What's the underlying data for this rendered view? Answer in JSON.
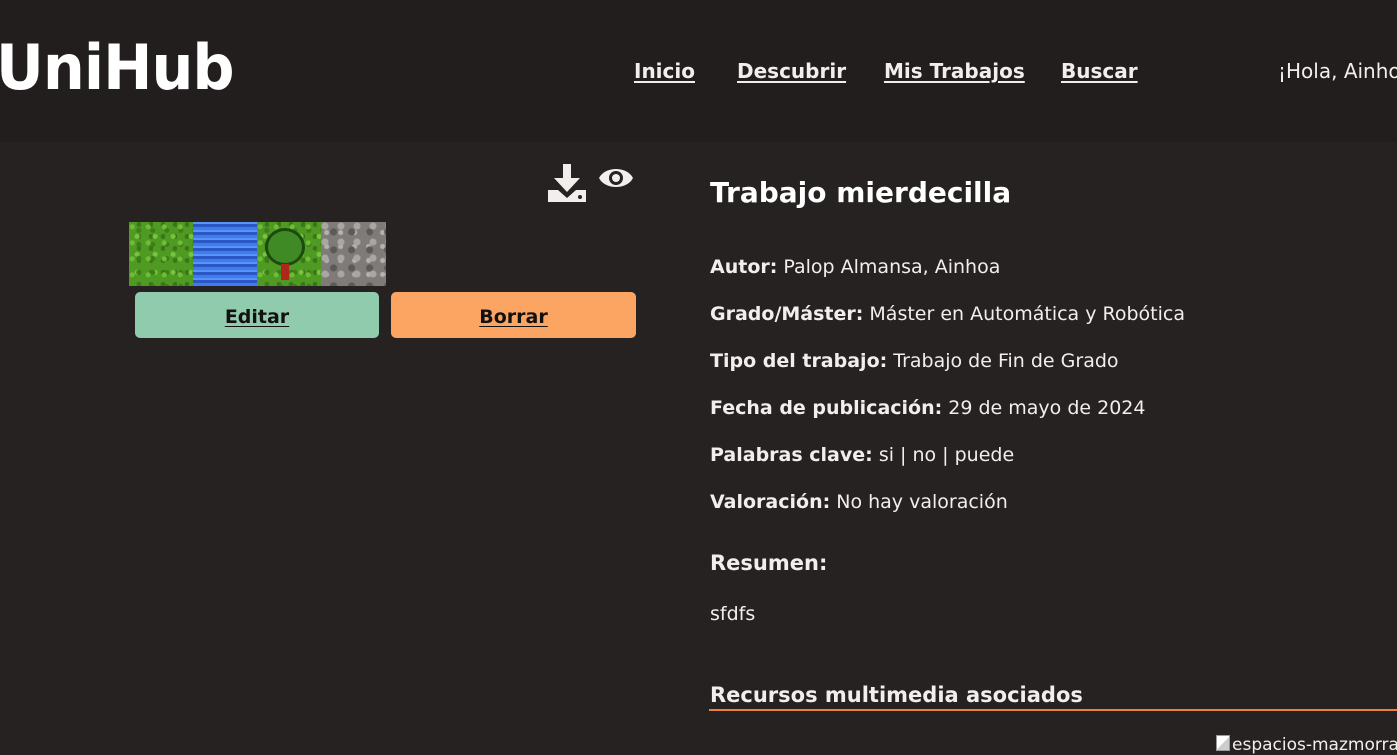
{
  "header": {
    "logo": "UniHub",
    "nav": [
      {
        "label": "Inicio"
      },
      {
        "label": "Descubrir"
      },
      {
        "label": "Mis Trabajos"
      },
      {
        "label": "Buscar"
      }
    ],
    "greeting": "¡Hola, Ainhoa"
  },
  "actions": {
    "download_icon": "download-icon",
    "view_icon": "eye-icon",
    "edit_label": "Editar",
    "delete_label": "Borrar"
  },
  "work": {
    "title": "Trabajo mierdecilla",
    "fields": [
      {
        "label": "Autor:",
        "value": "Palop Almansa, Ainhoa"
      },
      {
        "label": "Grado/Máster:",
        "value": "Máster en Automática y Robótica"
      },
      {
        "label": "Tipo del trabajo:",
        "value": "Trabajo de Fin de Grado"
      },
      {
        "label": "Fecha de publicación:",
        "value": "29 de mayo de 2024"
      },
      {
        "label": "Palabras clave:",
        "value": "si | no | puede"
      },
      {
        "label": "Valoración:",
        "value": "No hay valoración"
      }
    ],
    "summary_heading": "Resumen:",
    "summary_text": "sfdfs",
    "resources_heading": "Recursos multimedia asociados",
    "resource_alt": "espacios-mazmorra"
  },
  "colors": {
    "background": "#262222",
    "header_bg": "#221e1e",
    "edit_button": "#91cbad",
    "delete_button": "#fca562",
    "accent_rule": "#e8823c"
  }
}
